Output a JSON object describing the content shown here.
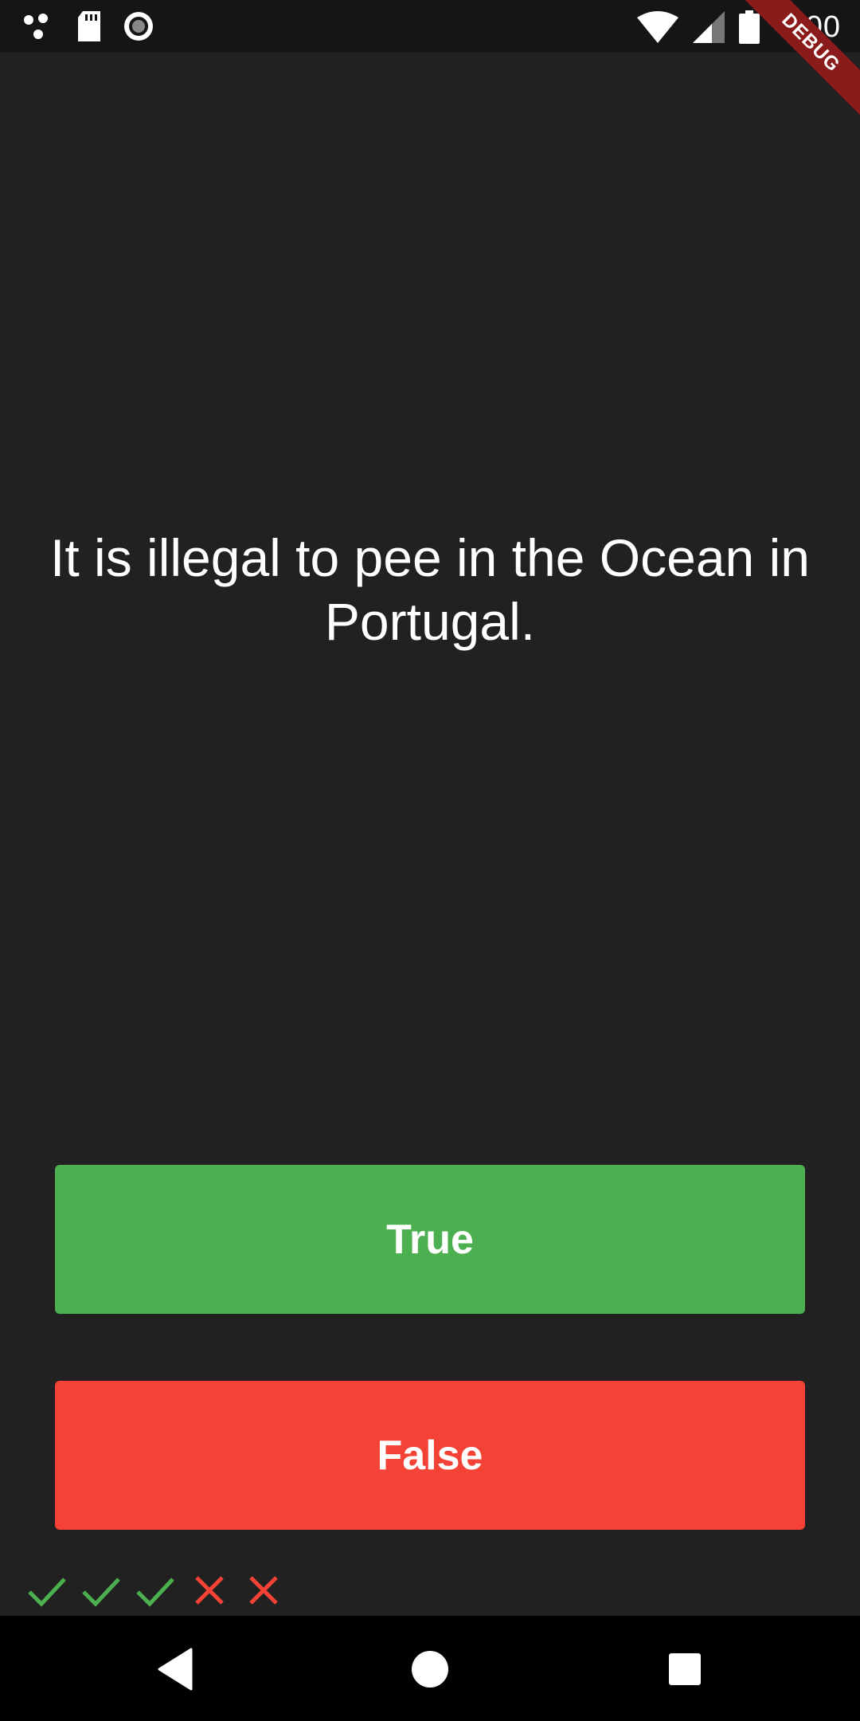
{
  "status_bar": {
    "time": "5:00",
    "left_icons": [
      "cluster-dots-icon",
      "sd-card-icon",
      "record-circle-icon"
    ],
    "right_icons": [
      "wifi-icon",
      "cell-signal-icon",
      "battery-icon"
    ]
  },
  "debug_banner": {
    "label": "DEBUG",
    "color": "#8b1a1a"
  },
  "quiz": {
    "question": "It is illegal to pee in the Ocean in Portugal.",
    "true_button_label": "True",
    "false_button_label": "False",
    "colors": {
      "true": "#4caf50",
      "false": "#f44336",
      "background": "#212121"
    }
  },
  "score_keeper": [
    {
      "result": "correct",
      "icon": "check-icon",
      "color": "#4caf50"
    },
    {
      "result": "correct",
      "icon": "check-icon",
      "color": "#4caf50"
    },
    {
      "result": "correct",
      "icon": "check-icon",
      "color": "#4caf50"
    },
    {
      "result": "wrong",
      "icon": "close-icon",
      "color": "#f44336"
    },
    {
      "result": "wrong",
      "icon": "close-icon",
      "color": "#f44336"
    }
  ],
  "nav_bar": {
    "buttons": [
      "back-icon",
      "home-icon",
      "recents-icon"
    ]
  }
}
